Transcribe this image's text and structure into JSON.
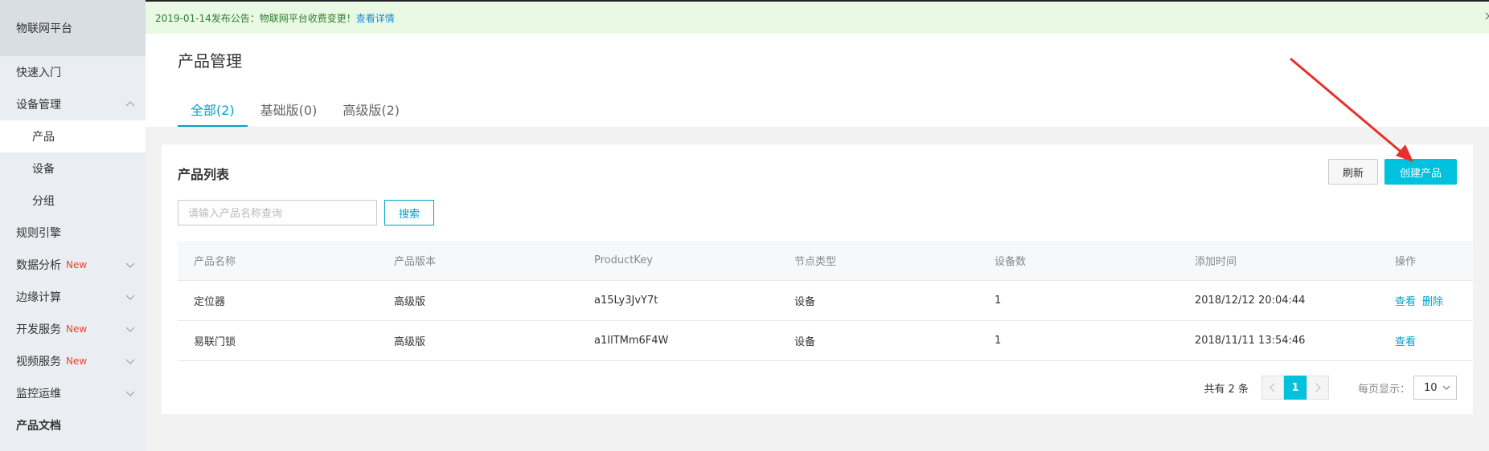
{
  "sidebar": {
    "title": "物联网平台",
    "items": [
      {
        "label": "快速入门",
        "new": ""
      },
      {
        "label": "设备管理",
        "new": ""
      },
      {
        "label": "产品",
        "new": ""
      },
      {
        "label": "设备",
        "new": ""
      },
      {
        "label": "分组",
        "new": ""
      },
      {
        "label": "规则引擎",
        "new": ""
      },
      {
        "label": "数据分析",
        "new": "New"
      },
      {
        "label": "边缘计算",
        "new": ""
      },
      {
        "label": "开发服务",
        "new": "New"
      },
      {
        "label": "视频服务",
        "new": "New"
      },
      {
        "label": "监控运维",
        "new": ""
      },
      {
        "label": "产品文档",
        "new": ""
      }
    ]
  },
  "notice": {
    "text": "2019-01-14发布公告：物联网平台收费变更！",
    "link": "查看详情"
  },
  "page": {
    "title": "产品管理",
    "tabs": [
      "全部(2)",
      "基础版(0)",
      "高级版(2)"
    ]
  },
  "card": {
    "title": "产品列表",
    "refresh_label": "刷新",
    "create_label": "创建产品",
    "search_placeholder": "请输入产品名称查询",
    "search_label": "搜索"
  },
  "table": {
    "headers": [
      "产品名称",
      "产品版本",
      "ProductKey",
      "节点类型",
      "设备数",
      "添加时间",
      "操作"
    ],
    "rows": [
      {
        "name": "定位器",
        "version": "高级版",
        "key": "a15Ly3JvY7t",
        "node": "设备",
        "count": "1",
        "time": "2018/12/12 20:04:44",
        "actions": [
          "查看",
          "删除"
        ]
      },
      {
        "name": "易联门锁",
        "version": "高级版",
        "key": "a1IlTMm6F4W",
        "node": "设备",
        "count": "1",
        "time": "2018/11/11 13:54:46",
        "actions": [
          "查看"
        ]
      }
    ]
  },
  "pagination": {
    "total_text": "共有 2 条",
    "current_page": "1",
    "page_size_label": "每页显示：",
    "page_size": "10"
  },
  "colors": {
    "accent": "#00c1de",
    "link": "#00a2ca",
    "new_badge": "#f04134",
    "annotation_arrow": "#e8302a"
  }
}
